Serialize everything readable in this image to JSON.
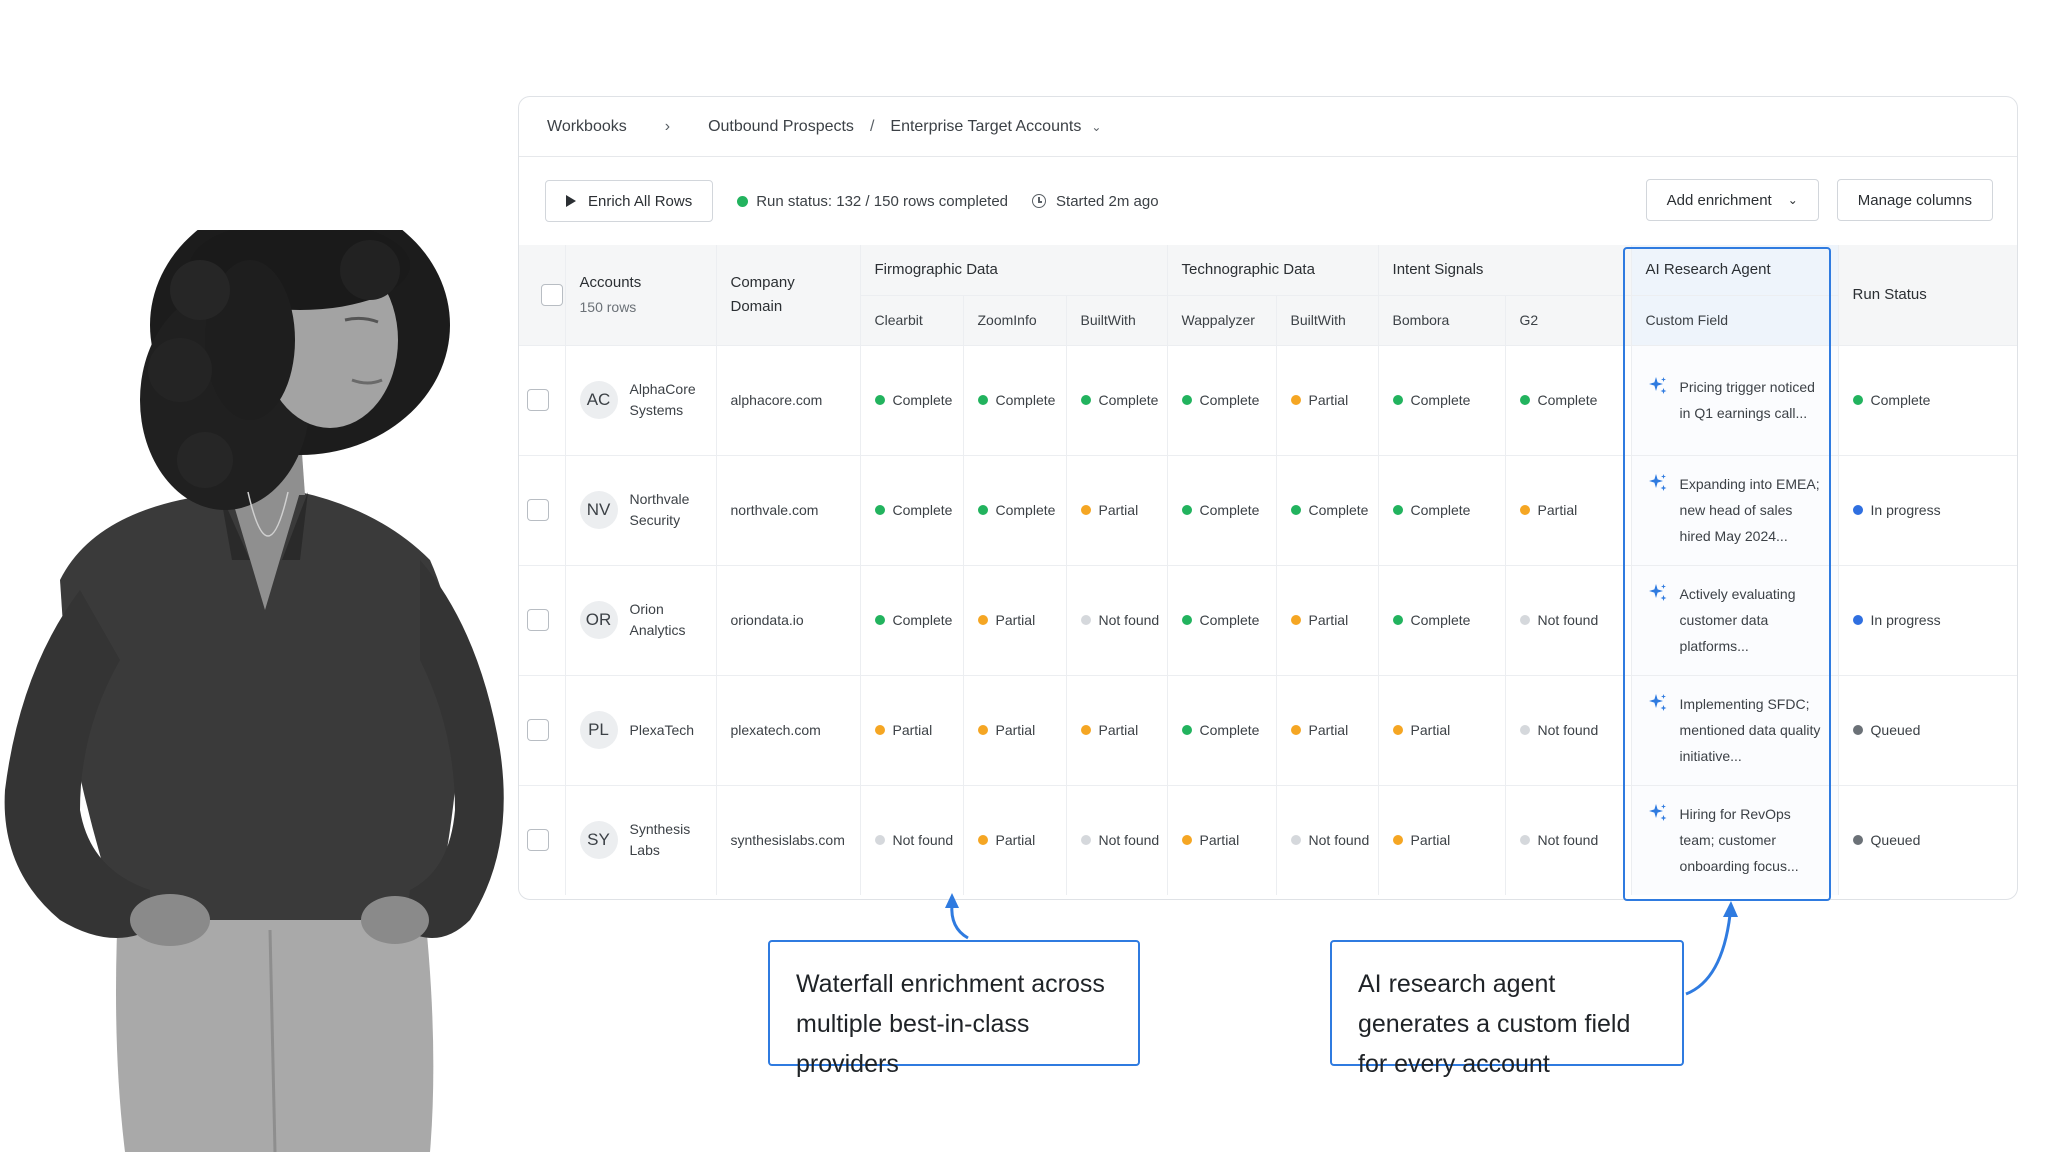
{
  "breadcrumb": {
    "root": "Workbooks",
    "parent": "Outbound Prospects",
    "current": "Enterprise Target Accounts"
  },
  "toolbar": {
    "enrich_label": "Enrich All Rows",
    "run_status": "Run status: 132 / 150 rows completed",
    "started": "Started 2m ago",
    "add_enrichment_label": "Add enrichment",
    "manage_columns_label": "Manage columns"
  },
  "colors": {
    "complete": "#22b35e",
    "partial": "#f5a623",
    "not_found": "#d5d8dc",
    "in_progress": "#2f6fe0",
    "queued": "#6b7177",
    "accent": "#2f7be0"
  },
  "table": {
    "accounts_header": "Accounts",
    "accounts_count": "150 rows",
    "domain_header_line1": "Company",
    "domain_header_line2": "Domain",
    "groups": {
      "firmographic": "Firmographic Data",
      "technographic": "Technographic Data",
      "intent": "Intent Signals",
      "ai": "AI Research Agent",
      "run_status": "Run Status"
    },
    "providers": {
      "clearbit": "Clearbit",
      "zoominfo": "ZoomInfo",
      "builtwith1": "BuiltWith",
      "wappalyzer": "Wappalyzer",
      "builtwith2": "BuiltWith",
      "bombora": "Bombora",
      "g2": "G2",
      "custom_field": "Custom Field"
    },
    "rows": [
      {
        "initials": "AC",
        "name": "AlphaCore Systems",
        "domain": "alphacore.com",
        "clearbit": "Complete",
        "zoominfo": "Complete",
        "builtwith1": "Complete",
        "wappalyzer": "Complete",
        "builtwith2": "Partial",
        "bombora": "Complete",
        "g2": "Complete",
        "ai": "Pricing trigger noticed in Q1 earnings call...",
        "run": "Complete"
      },
      {
        "initials": "NV",
        "name": "Northvale Security",
        "domain": "northvale.com",
        "clearbit": "Complete",
        "zoominfo": "Complete",
        "builtwith1": "Partial",
        "wappalyzer": "Complete",
        "builtwith2": "Complete",
        "bombora": "Complete",
        "g2": "Partial",
        "ai": "Expanding into EMEA; new head of sales hired May 2024...",
        "run": "In progress"
      },
      {
        "initials": "OR",
        "name": "Orion Analytics",
        "domain": "oriondata.io",
        "clearbit": "Complete",
        "zoominfo": "Partial",
        "builtwith1": "Not found",
        "wappalyzer": "Complete",
        "builtwith2": "Partial",
        "bombora": "Complete",
        "g2": "Not found",
        "ai": "Actively evaluating customer data platforms...",
        "run": "In progress"
      },
      {
        "initials": "PL",
        "name": "PlexaTech",
        "domain": "plexatech.com",
        "clearbit": "Partial",
        "zoominfo": "Partial",
        "builtwith1": "Partial",
        "wappalyzer": "Complete",
        "builtwith2": "Partial",
        "bombora": "Partial",
        "g2": "Not found",
        "ai": "Implementing SFDC; mentioned data quality initiative...",
        "run": "Queued"
      },
      {
        "initials": "SY",
        "name": "Synthesis Labs",
        "domain": "synthesislabs.com",
        "clearbit": "Not found",
        "zoominfo": "Partial",
        "builtwith1": "Not found",
        "wappalyzer": "Partial",
        "builtwith2": "Not found",
        "bombora": "Partial",
        "g2": "Not found",
        "ai": "Hiring for RevOps team; customer onboarding focus...",
        "run": "Queued"
      }
    ]
  },
  "callouts": {
    "waterfall": "Waterfall enrichment across multiple best-in-class providers",
    "ai": "AI research agent generates a custom field for every account"
  },
  "icons": {
    "play": "play-icon",
    "clock": "clock-icon",
    "caret": "chevron-down-icon",
    "sparkle": "sparkle-icon"
  }
}
